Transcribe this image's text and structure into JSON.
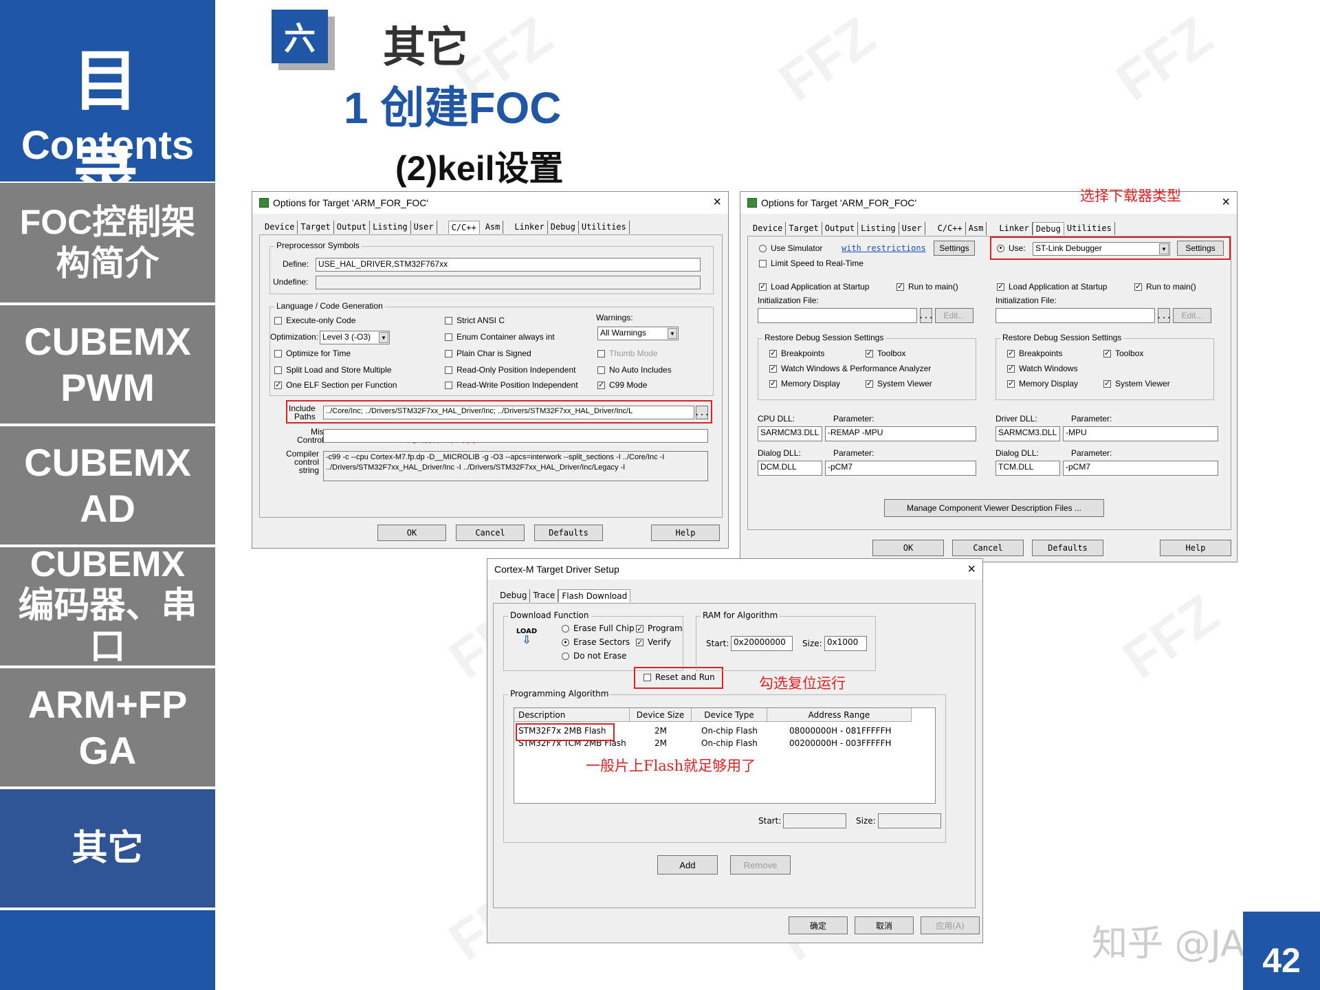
{
  "sidebar": {
    "head_cn": "目 录",
    "head_en": "Contents",
    "items": [
      {
        "line1": "FOC控制架",
        "line2": "构简介"
      },
      {
        "line1": "CUBEMX",
        "line2": "PWM"
      },
      {
        "line1": "CUBEMX",
        "line2": "AD"
      },
      {
        "line1": "CUBEMX",
        "line2": "编码器、串",
        "line3": "口"
      },
      {
        "line1": "ARM+FP",
        "line2": "GA"
      },
      {
        "line1": "其它"
      }
    ]
  },
  "header": {
    "badge": "六",
    "title": "其它",
    "subtitle": "1 创建FOC",
    "subsub": "(2)keil设置"
  },
  "win1": {
    "title": "Options for Target 'ARM_FOR_FOC'",
    "tabs": [
      "Device",
      "Target",
      "Output",
      "Listing",
      "User",
      "C/C++",
      "Asm",
      "Linker",
      "Debug",
      "Utilities"
    ],
    "preproc_group": "Preprocessor Symbols",
    "define_label": "Define:",
    "define_value": "USE_HAL_DRIVER,STM32F767xx",
    "undefine_label": "Undefine:",
    "lang_group": "Language / Code Generation",
    "execute_only": "Execute-only Code",
    "optimization_label": "Optimization:",
    "optimization_value": "Level 3 (-O3)",
    "optimize_time": "Optimize for Time",
    "split_load": "Split Load and Store Multiple",
    "one_elf": "One ELF Section per Function",
    "strict_ansi": "Strict ANSI C",
    "enum_container": "Enum Container always int",
    "plain_char": "Plain Char is Signed",
    "ro_pos": "Read-Only Position Independent",
    "rw_pos": "Read-Write Position Independent",
    "warnings_label": "Warnings:",
    "warnings_value": "All Warnings",
    "thumb_mode": "Thumb Mode",
    "no_auto": "No Auto Includes",
    "c99": "C99 Mode",
    "include_label1": "Include",
    "include_label2": "Paths",
    "include_value": "../Core/Inc;    ../Drivers/STM32F7xx_HAL_Driver/Inc;    ../Drivers/STM32F7xx_HAL_Driver/Inc/L",
    "misc_label1": "Misc",
    "misc_label2": "Controls",
    "compiler_label1": "Compiler",
    "compiler_label2": "control",
    "compiler_label3": "string",
    "compiler_line1": "-c99 -c --cpu Cortex-M7.fp.dp -D__MICROLIB -g -O3 --apcs=interwork --split_sections -I ../Core/Inc -I",
    "compiler_line2": "../Drivers/STM32F7xx_HAL_Driver/Inc -I ../Drivers/STM32F7xx_HAL_Driver/Inc/Legacy -I",
    "annotation": "添加头文件",
    "btn_ok": "OK",
    "btn_cancel": "Cancel",
    "btn_defaults": "Defaults",
    "btn_help": "Help",
    "browse": "..."
  },
  "win2": {
    "title": "Options for Target 'ARM_FOR_FOC'",
    "annotation": "选择下载器类型",
    "tabs": [
      "Device",
      "Target",
      "Output",
      "Listing",
      "User",
      "C/C++",
      "Asm",
      "Linker",
      "Debug",
      "Utilities"
    ],
    "use_simulator": "Use Simulator",
    "restrictions_link": "with restrictions",
    "settings": "Settings",
    "limit_speed": "Limit Speed to Real-Time",
    "use_label": "Use:",
    "debugger_value": "ST-Link Debugger",
    "load_app": "Load Application at Startup",
    "run_to_main": "Run to main()",
    "init_file": "Initialization File:",
    "edit": "Edit...",
    "browse": "...",
    "restore_group": "Restore Debug Session Settings",
    "breakpoints": "Breakpoints",
    "toolbox": "Toolbox",
    "watch_windows_perf": "Watch Windows & Performance Analyzer",
    "watch_windows": "Watch Windows",
    "memory_display": "Memory Display",
    "system_viewer": "System Viewer",
    "cpu_dll": "CPU DLL:",
    "driver_dll": "Driver DLL:",
    "parameter": "Parameter:",
    "cpu_dll_value": "SARMCM3.DLL",
    "cpu_param_value": "-REMAP -MPU",
    "driver_dll_value": "SARMCM3.DLL",
    "driver_param_value": "-MPU",
    "dialog_dll": "Dialog DLL:",
    "dialog_dll_left": "DCM.DLL",
    "dialog_param_left": "-pCM7",
    "dialog_dll_right": "TCM.DLL",
    "dialog_param_right": "-pCM7",
    "manage_btn": "Manage Component Viewer Description Files ...",
    "btn_ok": "OK",
    "btn_cancel": "Cancel",
    "btn_defaults": "Defaults",
    "btn_help": "Help"
  },
  "win3": {
    "title": "Cortex-M Target Driver Setup",
    "tabs": [
      "Debug",
      "Trace",
      "Flash Download"
    ],
    "download_group": "Download Function",
    "load_icon": "LOAD",
    "erase_full": "Erase Full Chip",
    "erase_sectors": "Erase Sectors",
    "do_not_erase": "Do not Erase",
    "program": "Program",
    "verify": "Verify",
    "reset_run": "Reset and Run",
    "ram_group": "RAM for Algorithm",
    "start_label": "Start:",
    "start_value": "0x20000000",
    "size_label": "Size:",
    "size_value": "0x1000",
    "annotation_reset": "勾选复位运行",
    "prog_group": "Programming Algorithm",
    "cols": [
      "Description",
      "Device Size",
      "Device Type",
      "Address Range"
    ],
    "rows": [
      {
        "desc": "STM32F7x 2MB Flash",
        "size": "2M",
        "type": "On-chip Flash",
        "range": "08000000H - 081FFFFFH"
      },
      {
        "desc": "STM32F7x TCM 2MB Flash",
        "size": "2M",
        "type": "On-chip Flash",
        "range": "00200000H - 003FFFFFH"
      }
    ],
    "annotation_flash": "一般片上Flash就足够用了",
    "start2": "Start:",
    "size2": "Size:",
    "btn_add": "Add",
    "btn_remove": "Remove",
    "btn_ok": "确定",
    "btn_cancel": "取消",
    "btn_apply": "应用(A)"
  },
  "footer": {
    "zhihu": "知乎 @JAS",
    "page": "42"
  },
  "colors": {
    "brand_blue": "#1f56a5",
    "sidebar_gray": "#7f7f7f",
    "annotation_red": "#e02020"
  }
}
